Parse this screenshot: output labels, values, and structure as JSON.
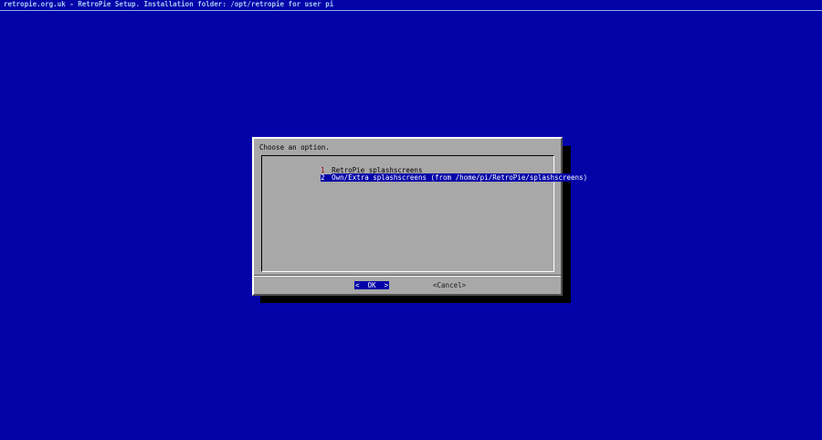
{
  "backtitle": "retropie.org.uk - RetroPie Setup. Installation folder: /opt/retropie for user pi",
  "dialog": {
    "prompt": "Choose an option.",
    "menu": [
      {
        "tag": "1",
        "label": "RetroPie splashscreens",
        "selected": false
      },
      {
        "tag": "2",
        "label": "Own/Extra splashscreens (from /home/pi/RetroPie/splashscreens)",
        "selected": true
      }
    ],
    "buttons": {
      "ok": "<  OK  >",
      "cancel": "<Cancel>"
    }
  },
  "colors": {
    "background": "#0303a8",
    "dialog": "#a8a8a8",
    "highlight": "#0303a8",
    "tag": "#a80000"
  }
}
